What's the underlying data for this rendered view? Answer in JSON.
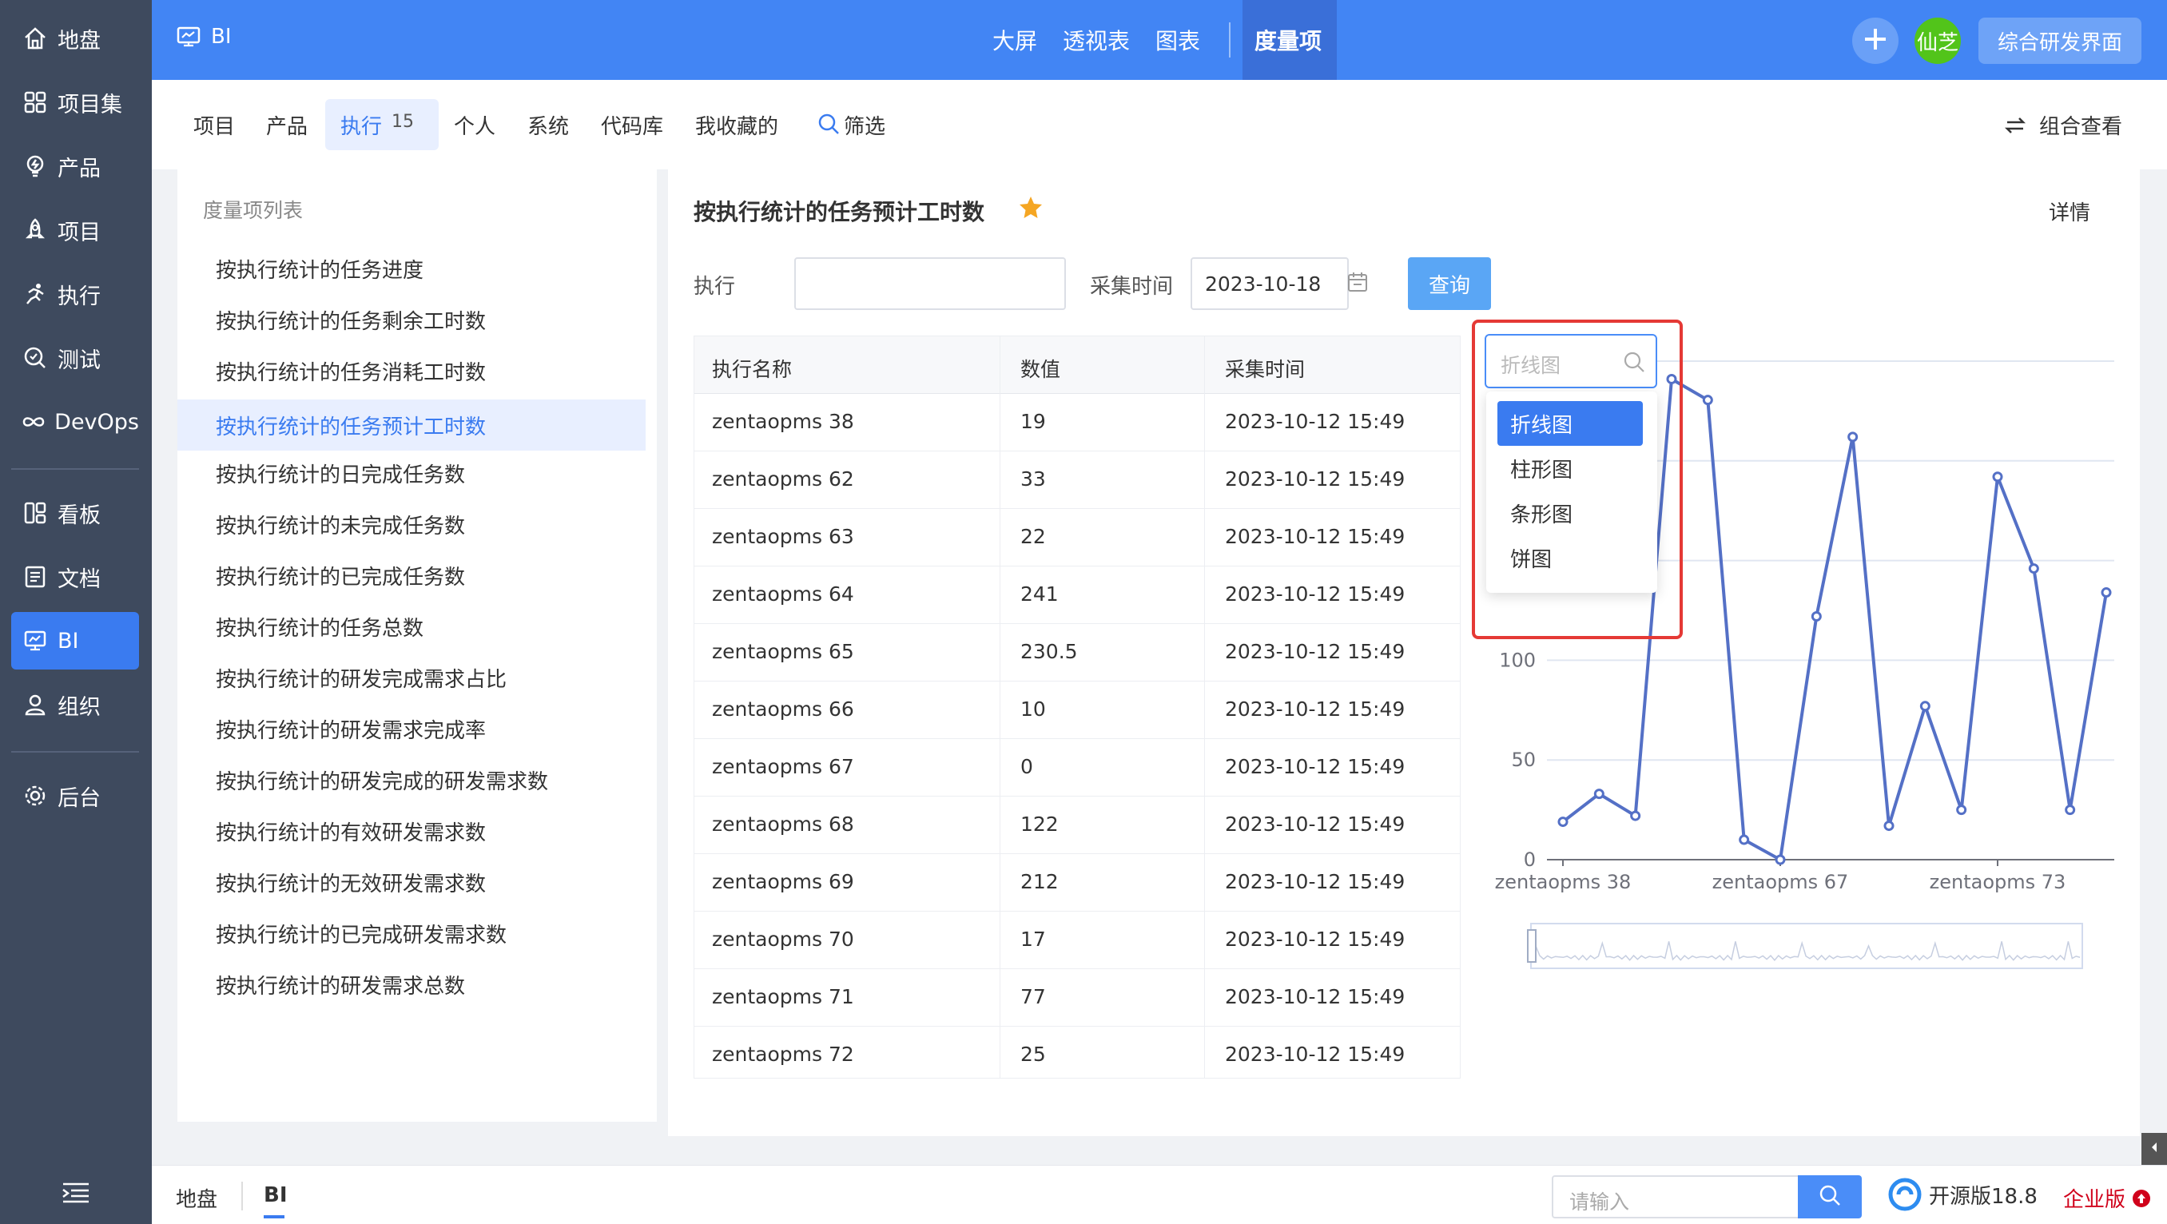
{
  "sidebar": {
    "items": [
      {
        "label": "地盘",
        "icon": "home-icon"
      },
      {
        "label": "项目集",
        "icon": "grid-icon"
      },
      {
        "label": "产品",
        "icon": "lightbulb-icon"
      },
      {
        "label": "项目",
        "icon": "rocket-icon"
      },
      {
        "label": "执行",
        "icon": "run-icon"
      },
      {
        "label": "测试",
        "icon": "search-check-icon"
      },
      {
        "label": "DevOps",
        "icon": "infinity-icon"
      },
      {
        "label": "看板",
        "icon": "kanban-icon"
      },
      {
        "label": "文档",
        "icon": "document-icon"
      },
      {
        "label": "BI",
        "icon": "monitor-icon"
      },
      {
        "label": "组织",
        "icon": "user-icon"
      },
      {
        "label": "后台",
        "icon": "gear-icon"
      }
    ]
  },
  "header": {
    "app_title": "BI",
    "nav": [
      "大屏",
      "透视表",
      "图表",
      "度量项"
    ],
    "avatar_text": "仙芝",
    "rd_button": "综合研发界面",
    "colors": {
      "primary": "#4285f4",
      "active": "#3a6fd8"
    }
  },
  "subnav": {
    "items": [
      "项目",
      "产品",
      "执行",
      "个人",
      "系统",
      "代码库",
      "我收藏的"
    ],
    "active_badge": "15",
    "filter": "筛选",
    "combo_view": "组合查看"
  },
  "metric_list": {
    "title": "度量项列表",
    "items": [
      "按执行统计的任务进度",
      "按执行统计的任务剩余工时数",
      "按执行统计的任务消耗工时数",
      "按执行统计的任务预计工时数",
      "按执行统计的日完成任务数",
      "按执行统计的未完成任务数",
      "按执行统计的已完成任务数",
      "按执行统计的任务总数",
      "按执行统计的研发完成需求占比",
      "按执行统计的研发需求完成率",
      "按执行统计的研发完成的研发需求数",
      "按执行统计的有效研发需求数",
      "按执行统计的无效研发需求数",
      "按执行统计的已完成研发需求数",
      "按执行统计的研发需求总数"
    ]
  },
  "main": {
    "title": "按执行统计的任务预计工时数",
    "detail": "详情",
    "filters": {
      "exec_label": "执行",
      "time_label": "采集时间",
      "date_value": "2023-10-18",
      "query_button": "查询"
    },
    "table": {
      "headers": [
        "执行名称",
        "数值",
        "采集时间"
      ],
      "rows": [
        [
          "zentaopms 38",
          "19",
          "2023-10-12 15:49"
        ],
        [
          "zentaopms 62",
          "33",
          "2023-10-12 15:49"
        ],
        [
          "zentaopms 63",
          "22",
          "2023-10-12 15:49"
        ],
        [
          "zentaopms 64",
          "241",
          "2023-10-12 15:49"
        ],
        [
          "zentaopms 65",
          "230.5",
          "2023-10-12 15:49"
        ],
        [
          "zentaopms 66",
          "10",
          "2023-10-12 15:49"
        ],
        [
          "zentaopms 67",
          "0",
          "2023-10-12 15:49"
        ],
        [
          "zentaopms 68",
          "122",
          "2023-10-12 15:49"
        ],
        [
          "zentaopms 69",
          "212",
          "2023-10-12 15:49"
        ],
        [
          "zentaopms 70",
          "17",
          "2023-10-12 15:49"
        ],
        [
          "zentaopms 71",
          "77",
          "2023-10-12 15:49"
        ],
        [
          "zentaopms 72",
          "25",
          "2023-10-12 15:49"
        ]
      ]
    },
    "chart_type_selector": {
      "placeholder": "折线图",
      "options": [
        "折线图",
        "柱形图",
        "条形图",
        "饼图"
      ],
      "selected": "折线图"
    }
  },
  "chart_data": {
    "type": "line",
    "x": [
      "zentaopms 38",
      "zentaopms 62",
      "zentaopms 63",
      "zentaopms 64",
      "zentaopms 65",
      "zentaopms 66",
      "zentaopms 67",
      "zentaopms 68",
      "zentaopms 69",
      "zentaopms 70",
      "zentaopms 71",
      "zentaopms 72",
      "zentaopms 73",
      "",
      "",
      ""
    ],
    "values": [
      19,
      33,
      22,
      241,
      230.5,
      10,
      0,
      122,
      212,
      17,
      77,
      25,
      192,
      146,
      25,
      134
    ],
    "x_tick_labels": [
      "zentaopms 38",
      "zentaopms 67",
      "zentaopms 73"
    ],
    "y_ticks": [
      0,
      50,
      100,
      150
    ],
    "ylim": [
      0,
      250
    ],
    "grid": true,
    "color": "#5470c6"
  },
  "bottombar": {
    "crumbs": [
      "地盘",
      "BI"
    ],
    "search_placeholder": "请输入",
    "version": "开源版18.8",
    "enterprise": "企业版"
  }
}
